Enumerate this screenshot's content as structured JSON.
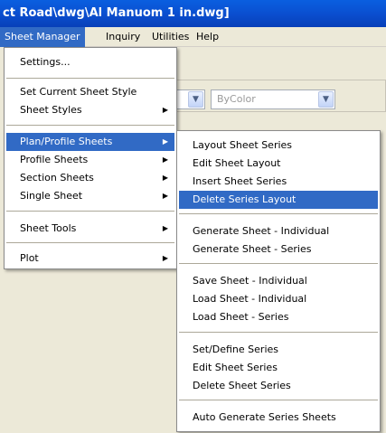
{
  "window": {
    "title": "ct Road\\dwg\\Al Manuom 1 in.dwg]"
  },
  "menubar": [
    "Sheet Manager",
    "Inquiry",
    "Utilities",
    "Help"
  ],
  "toolbar": {
    "color_combo_value": "ByColor"
  },
  "main_menu": {
    "items": [
      {
        "label": "Settings..."
      },
      {
        "label": "Set Current Sheet Style"
      },
      {
        "label": "Sheet Styles"
      },
      {
        "label": "Plan/Profile Sheets"
      },
      {
        "label": "Profile Sheets"
      },
      {
        "label": "Section Sheets"
      },
      {
        "label": "Single Sheet"
      },
      {
        "label": "Sheet Tools"
      },
      {
        "label": "Plot"
      }
    ]
  },
  "submenu": {
    "items": [
      {
        "label": "Layout Sheet Series"
      },
      {
        "label": "Edit Sheet Layout"
      },
      {
        "label": "Insert Sheet Series"
      },
      {
        "label": "Delete Series Layout"
      },
      {
        "label": "Generate Sheet - Individual"
      },
      {
        "label": "Generate Sheet - Series"
      },
      {
        "label": "Save Sheet - Individual"
      },
      {
        "label": "Load Sheet - Individual"
      },
      {
        "label": "Load Sheet - Series"
      },
      {
        "label": "Set/Define Series"
      },
      {
        "label": "Edit Sheet Series"
      },
      {
        "label": "Delete Sheet Series"
      },
      {
        "label": "Auto Generate Series Sheets"
      }
    ]
  },
  "icons": {
    "submenu_arrow": "▶",
    "dropdown_arrow": "▼"
  },
  "colors": {
    "title_bar": "#0a4fd0",
    "highlight": "#316ac5",
    "menu_bg": "#ffffff",
    "chrome": "#ece9d8"
  }
}
